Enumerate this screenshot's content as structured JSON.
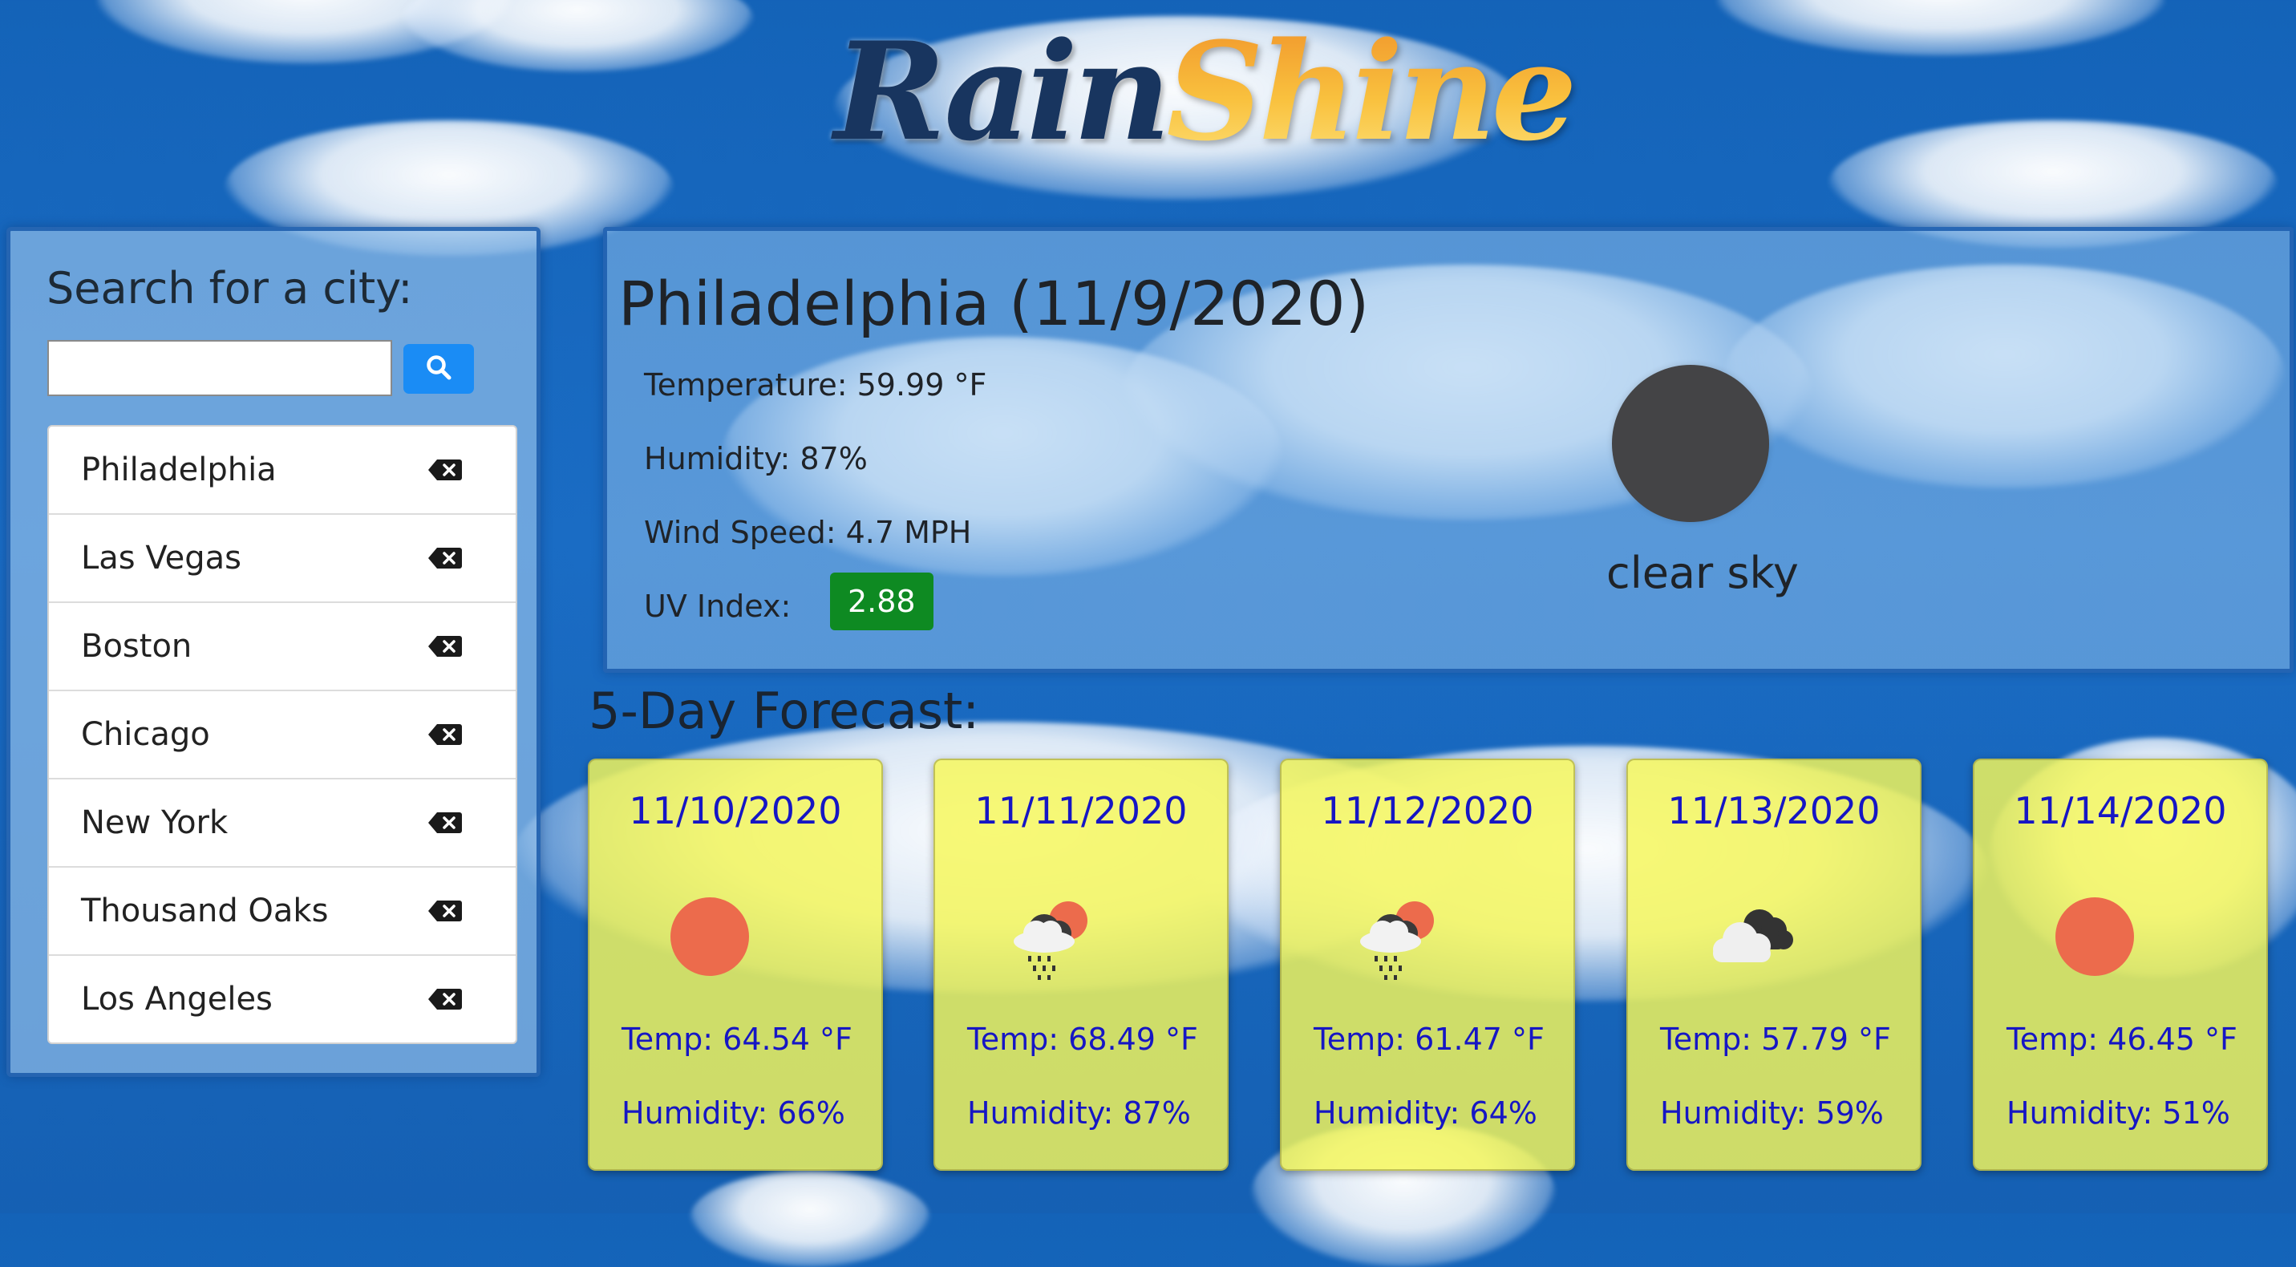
{
  "app": {
    "logo_part1": "Rain",
    "logo_part2": "Shine"
  },
  "sidebar": {
    "search_label": "Search for a city:",
    "search_placeholder": "",
    "search_value": "",
    "search_button_icon": "search-icon",
    "cities": [
      {
        "name": "Philadelphia"
      },
      {
        "name": "Las Vegas"
      },
      {
        "name": "Boston"
      },
      {
        "name": "Chicago"
      },
      {
        "name": "New York"
      },
      {
        "name": "Thousand Oaks"
      },
      {
        "name": "Los Angeles"
      }
    ],
    "delete_icon": "backspace-delete-icon"
  },
  "current": {
    "title": "Philadelphia (11/9/2020)",
    "temperature": "Temperature: 59.99 °F",
    "humidity": "Humidity: 87%",
    "wind_speed": "Wind Speed: 4.7 MPH",
    "uv_label": "UV Index:",
    "uv_value": "2.88",
    "uv_color": "#0e8a22",
    "condition": "clear sky",
    "condition_icon": "clear-sky-night-icon"
  },
  "forecast": {
    "title": "5-Day Forecast:",
    "days": [
      {
        "date": "11/10/2020",
        "icon": "sun-icon",
        "temp": "Temp: 64.54 °F",
        "humidity": "Humidity: 66%"
      },
      {
        "date": "11/11/2020",
        "icon": "sun-cloud-rain-icon",
        "temp": "Temp: 68.49 °F",
        "humidity": "Humidity: 87%"
      },
      {
        "date": "11/12/2020",
        "icon": "sun-cloud-rain-icon",
        "temp": "Temp: 61.47 °F",
        "humidity": "Humidity: 64%"
      },
      {
        "date": "11/13/2020",
        "icon": "broken-clouds-icon",
        "temp": "Temp: 57.79 °F",
        "humidity": "Humidity: 59%"
      },
      {
        "date": "11/14/2020",
        "icon": "sun-icon",
        "temp": "Temp: 46.45 °F",
        "humidity": "Humidity: 51%"
      }
    ]
  },
  "colors": {
    "background": "#1463b8",
    "forecast_card": "#f6f858",
    "forecast_text": "#1616c4",
    "search_button": "#1a8cf5",
    "sun": "#ec6b4c"
  }
}
